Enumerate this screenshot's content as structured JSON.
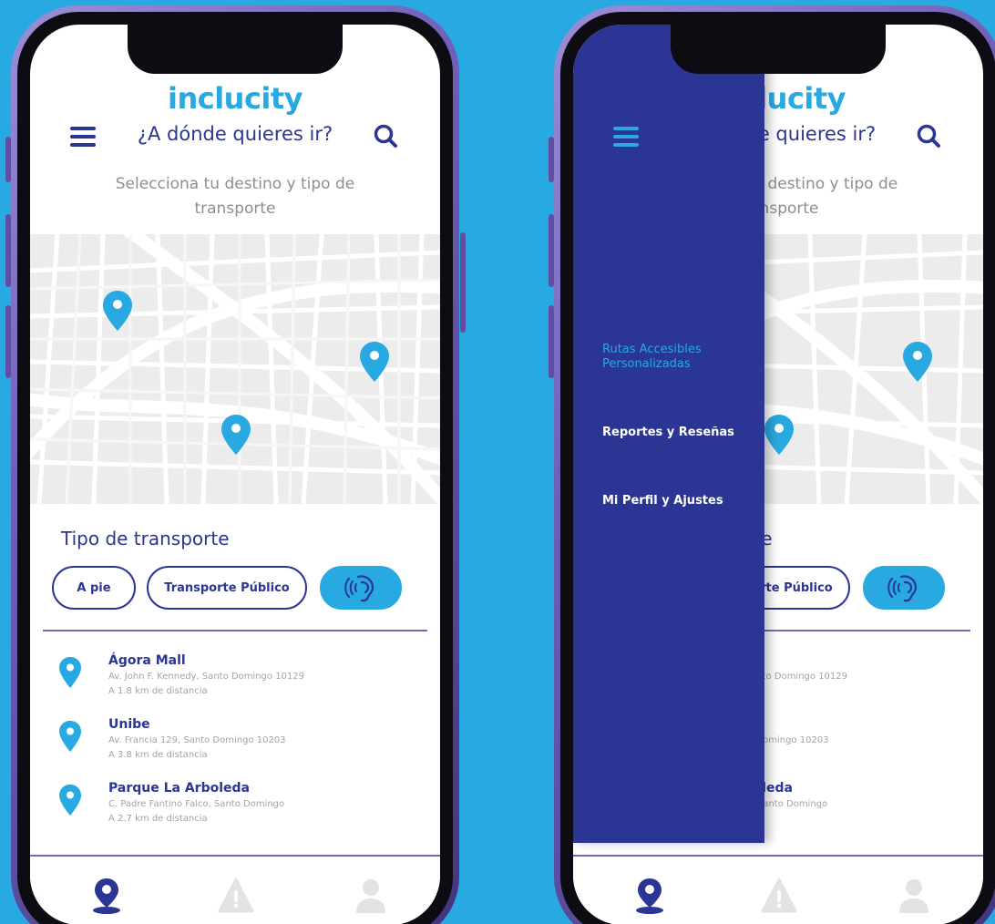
{
  "brand": {
    "name": "inclucity",
    "primary": "#2a3594",
    "accent": "#29a9e1",
    "background": "#29a9e1"
  },
  "screen": {
    "title": "¿A dónde quieres ir?",
    "subtitle": "Selecciona tu destino y tipo de transporte",
    "menu_icon": "hamburger-menu-icon",
    "search_icon": "search-icon"
  },
  "transport": {
    "section_title": "Tipo de transporte",
    "options": [
      "A pie",
      "Transporte Público"
    ],
    "audio_icon": "hearing-audio-icon"
  },
  "places": [
    {
      "name": "Ágora Mall",
      "address": "Av. John F. Kennedy, Santo Domingo 10129",
      "distance": "A 1.8 km de distancia"
    },
    {
      "name": "Unibe",
      "address": "Av. Francia 129, Santo Domingo 10203",
      "distance": "A 3.8 km de distancia"
    },
    {
      "name": "Parque La Arboleda",
      "address": "C. Padre Fantino Falco, Santo Domingo",
      "distance": "A 2.7 km de distancia"
    }
  ],
  "bottom_nav": [
    {
      "icon": "location-person-icon",
      "active": true
    },
    {
      "icon": "warning-icon",
      "active": false
    },
    {
      "icon": "user-icon",
      "active": false
    }
  ],
  "drawer": {
    "items": [
      {
        "label": "Rutas Accesibles\nPersonalizadas",
        "active": true
      },
      {
        "label": "Reportes y Reseñas",
        "active": false
      },
      {
        "label": "Mi Perfil y Ajustes",
        "active": false
      }
    ]
  }
}
